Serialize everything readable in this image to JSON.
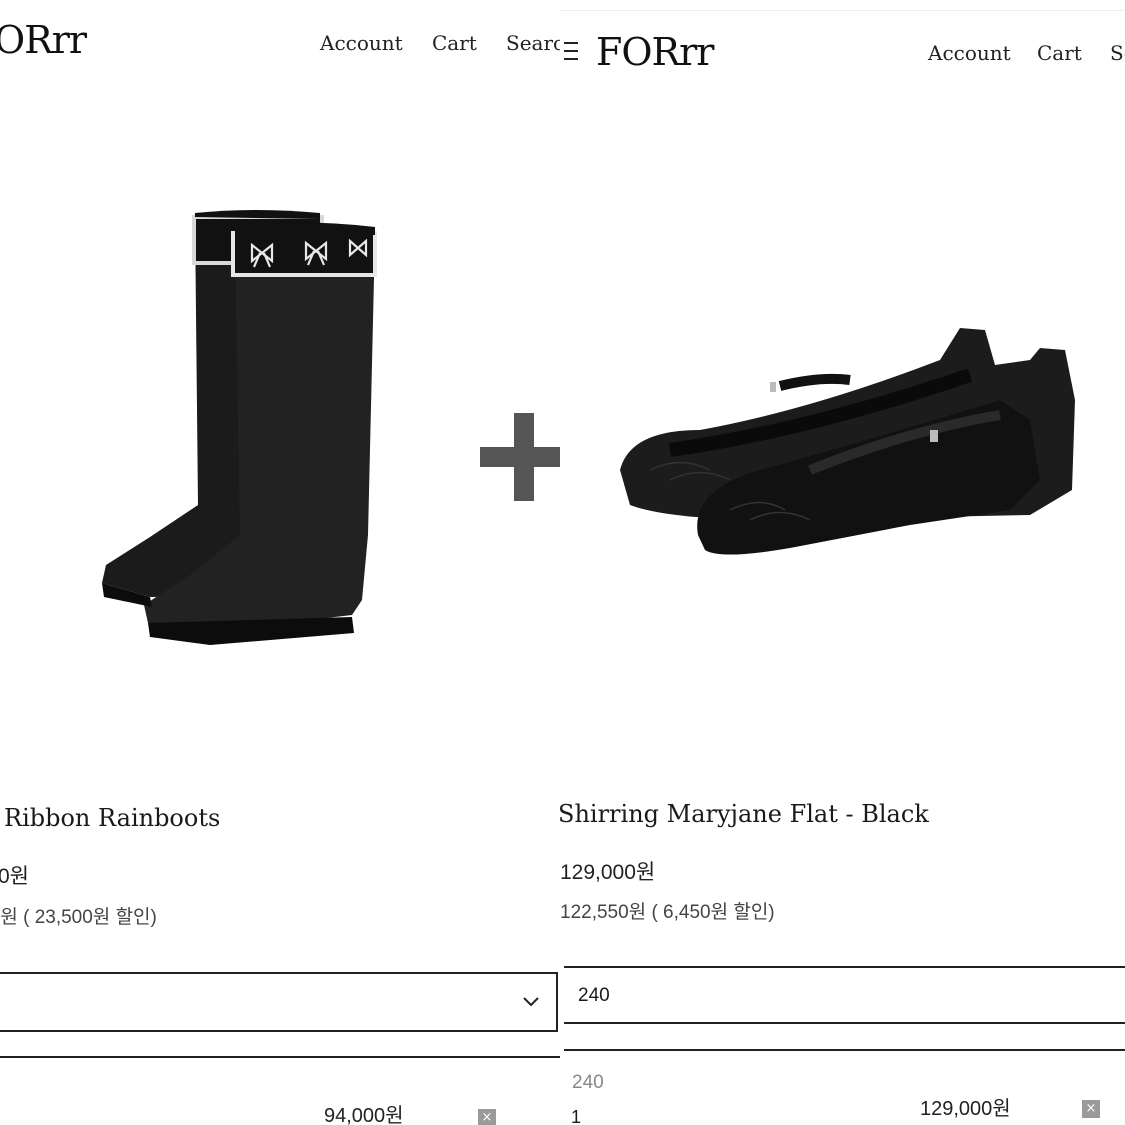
{
  "left": {
    "logo": "ORrr",
    "nav": [
      "Account",
      "Cart",
      "Search"
    ],
    "product_title": "Ribbon Rainboots",
    "price": "0원",
    "sale_price": ")원 ( 23,500원 할인)",
    "selected_option": "",
    "line_price": "94,000원",
    "remove_label": "×"
  },
  "plus_sign": "+",
  "right": {
    "logo": "FORrr",
    "nav": [
      "Account",
      "Cart",
      "Se"
    ],
    "product_title": "Shirring Maryjane Flat - Black",
    "price": "129,000원",
    "sale_price": "122,550원 ( 6,450원 할인)",
    "selected_option": "240",
    "option_label": "240",
    "quantity": "1",
    "line_price": "129,000원",
    "remove_label": "×"
  }
}
